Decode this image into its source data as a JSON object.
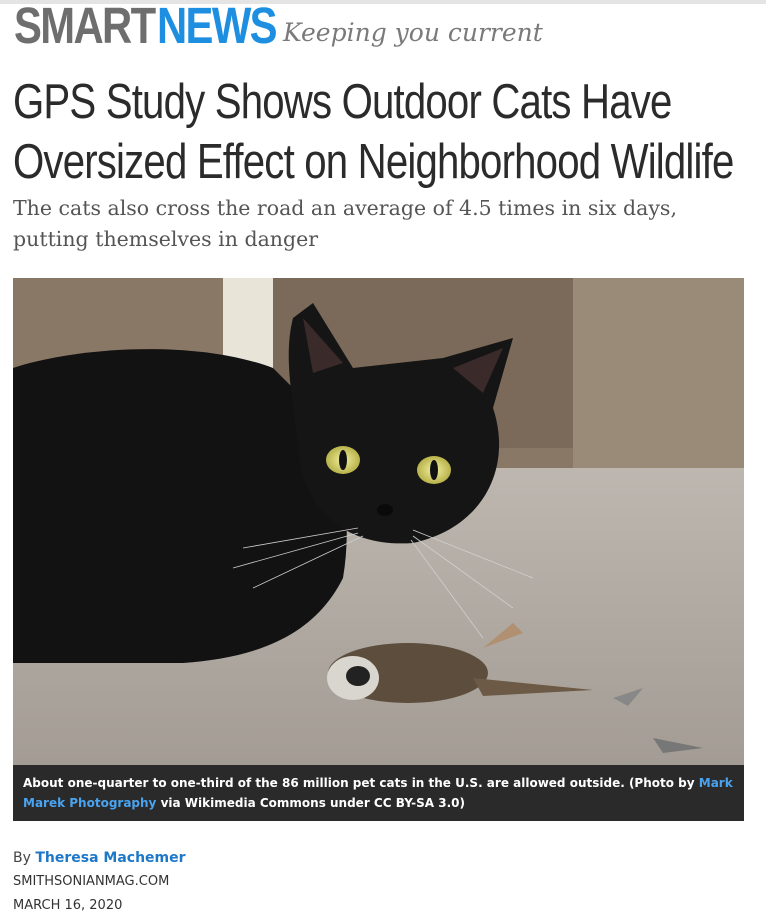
{
  "header": {
    "brand_smart": "SMART",
    "brand_news": "NEWS",
    "tagline": "Keeping you current"
  },
  "article": {
    "headline_line1": "GPS Study Shows Outdoor Cats Have",
    "headline_line2": "Oversized Effect on Neighborhood Wildlife",
    "subhead": "The cats also cross the road an average of 4.5 times in six days, putting themselves in danger"
  },
  "caption": {
    "text_before": "About one-quarter to one-third of the 86 million pet cats in the U.S. are allowed outside. (Photo by ",
    "link": "Mark Marek Photography",
    "text_after": " via Wikimedia Commons under CC BY-SA 3.0)"
  },
  "byline": {
    "prefix": "By ",
    "author": "Theresa Machemer",
    "source": "SMITHSONIANMAG.COM",
    "date": "MARCH 16, 2020"
  },
  "colors": {
    "brand_blue": "#1e8fe0",
    "brand_gray": "#6e6e6e",
    "caption_bg": "#2a2a2a",
    "link_blue": "#4aa3f0"
  }
}
